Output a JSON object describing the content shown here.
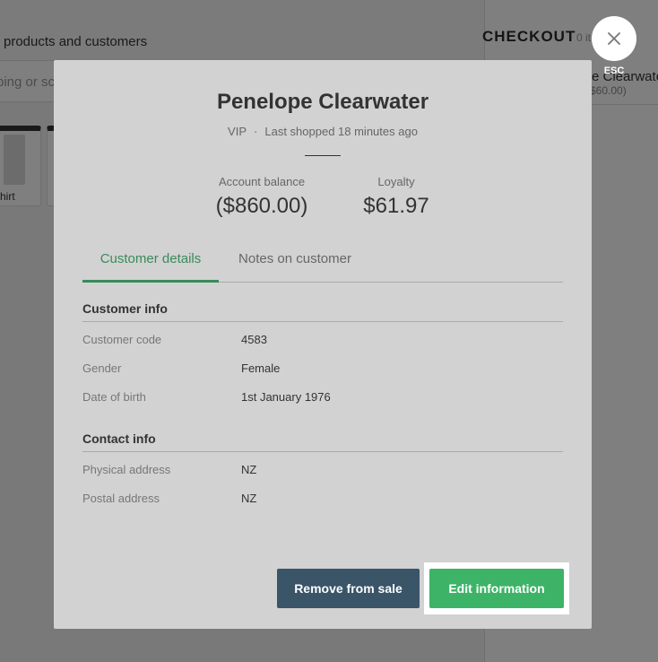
{
  "background": {
    "search_title": "products and customers",
    "search_placeholder": "ping or sca",
    "tile_label": "hirt",
    "checkout_title": "CHECKOUT",
    "checkout_count": "0 it",
    "customer_name": "e Clearwate",
    "customer_amount": "$60.00)"
  },
  "close": {
    "esc_label": "ESC"
  },
  "modal": {
    "title": "Penelope Clearwater",
    "badge": "VIP",
    "separator": "·",
    "last_shopped": "Last shopped 18 minutes ago",
    "account_balance": {
      "label": "Account balance",
      "value": "($860.00)"
    },
    "loyalty": {
      "label": "Loyalty",
      "value": "$61.97"
    },
    "tabs": [
      {
        "label": "Customer details",
        "active": true
      },
      {
        "label": "Notes on customer",
        "active": false
      }
    ],
    "customer_info": {
      "title": "Customer info",
      "rows": [
        {
          "label": "Customer code",
          "value": "4583"
        },
        {
          "label": "Gender",
          "value": "Female"
        },
        {
          "label": "Date of birth",
          "value": "1st January 1976"
        }
      ]
    },
    "contact_info": {
      "title": "Contact info",
      "rows": [
        {
          "label": "Physical address",
          "value": "NZ"
        },
        {
          "label": "Postal address",
          "value": "NZ"
        }
      ]
    },
    "buttons": {
      "remove": "Remove from sale",
      "edit": "Edit information"
    }
  },
  "colors": {
    "accent_green": "#3db368",
    "tab_green": "#3a8a5b",
    "remove_button": "#3a5468"
  }
}
